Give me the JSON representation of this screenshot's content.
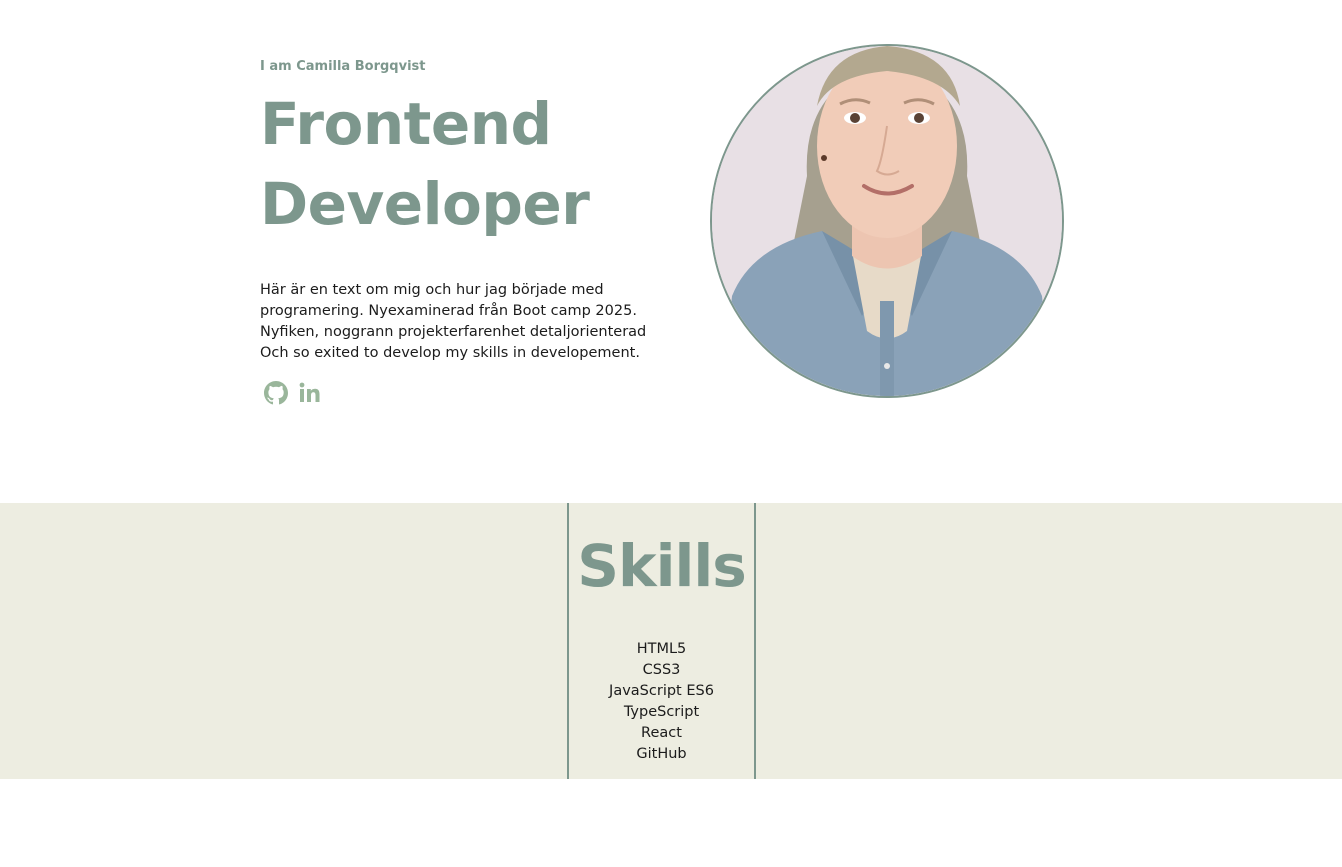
{
  "hero": {
    "intro": "I am Camilla Borgqvist",
    "title_line1": "Frontend",
    "title_line2": "Developer",
    "bio_lines": [
      "Här är en text om mig och hur jag började med",
      "programering. Nyexaminerad från Boot camp 2025.",
      "Nyfiken, noggrann projekterfarenhet detaljorienterad",
      "Och so exited to develop my skills in developement."
    ],
    "socials": [
      {
        "icon": "github-icon"
      },
      {
        "icon": "linkedin-icon"
      }
    ],
    "portrait": {
      "icon": "profile-photo"
    }
  },
  "skills": {
    "title": "Skills",
    "items": [
      "HTML5",
      "CSS3",
      "JavaScript ES6",
      "TypeScript",
      "React",
      "GitHub"
    ]
  },
  "colors": {
    "accent": "#7d978d",
    "icon": "#9ab69b",
    "skills_bg": "#edede1",
    "text": "#1c1c1c"
  }
}
